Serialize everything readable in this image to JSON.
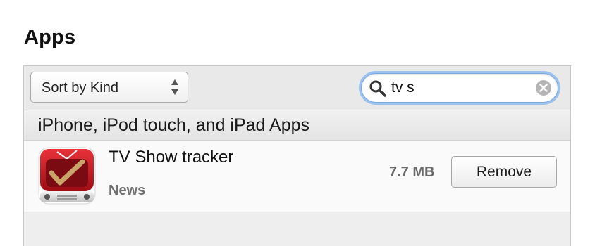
{
  "page": {
    "title": "Apps"
  },
  "toolbar": {
    "sort_label": "Sort by Kind",
    "sort_icon": "up-down-arrows-icon",
    "search": {
      "value": "tv s",
      "icon": "magnifier-search-icon",
      "clear_icon": "clear-x-icon",
      "focus_color": "#9cc3f0"
    }
  },
  "section": {
    "title": "iPhone, iPod touch, and iPad Apps"
  },
  "apps": [
    {
      "name": "TV Show tracker",
      "category": "News",
      "size": "7.7 MB",
      "action_label": "Remove",
      "icon": "tv-show-tracker-app-icon",
      "icon_color": "#b2121b"
    }
  ]
}
